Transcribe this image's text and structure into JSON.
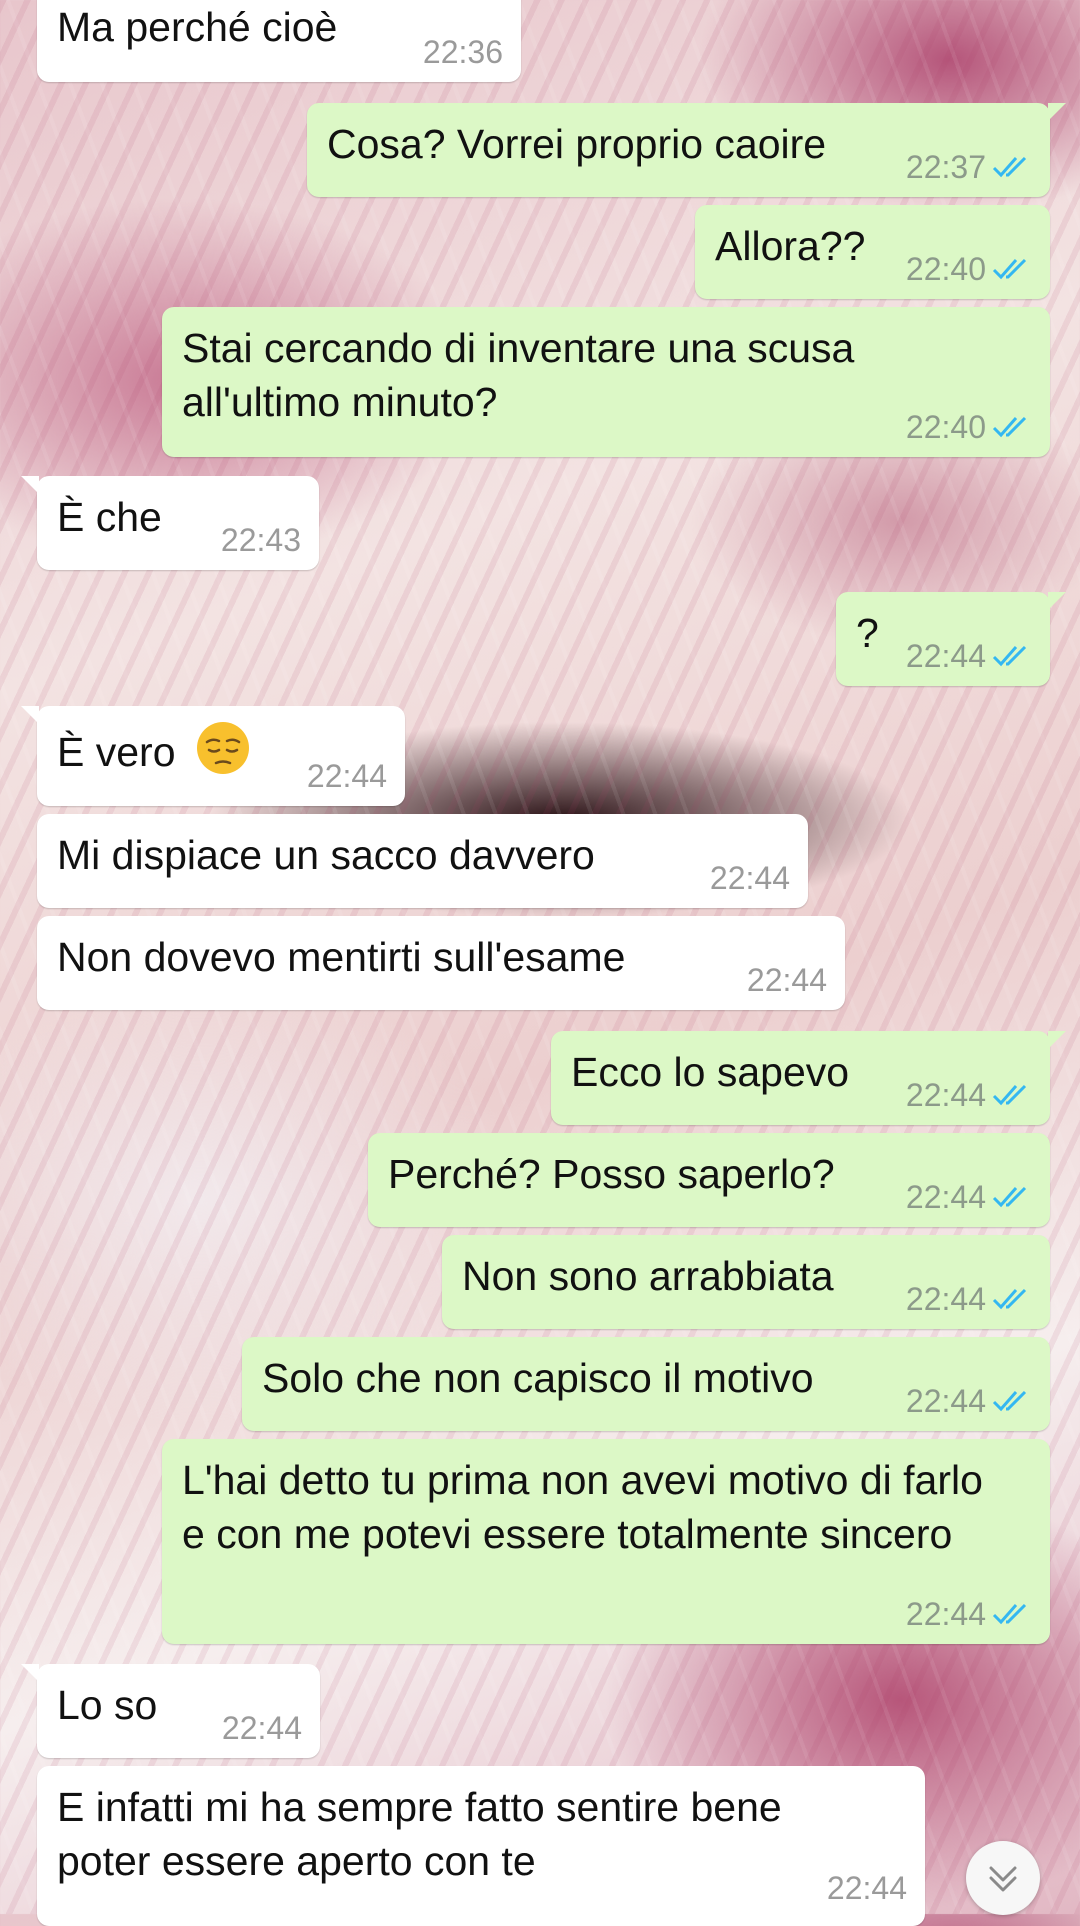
{
  "messages": [
    {
      "dir": "in",
      "text": "Ma perché cioè",
      "time": "22:36"
    },
    {
      "dir": "out",
      "text": "Cosa? Vorrei proprio caoire",
      "time": "22:37"
    },
    {
      "dir": "out",
      "text": "Allora??",
      "time": "22:40"
    },
    {
      "dir": "out",
      "text": "Stai cercando di inventare una scusa all'ultimo minuto?",
      "time": "22:40"
    },
    {
      "dir": "in",
      "text": "È che",
      "time": "22:43"
    },
    {
      "dir": "out",
      "text": "?",
      "time": "22:44"
    },
    {
      "dir": "in",
      "text": "È vero",
      "emoji": "pensive-face-emoji",
      "time": "22:44"
    },
    {
      "dir": "in",
      "text": "Mi dispiace un sacco davvero",
      "time": "22:44"
    },
    {
      "dir": "in",
      "text": "Non dovevo mentirti sull'esame",
      "time": "22:44"
    },
    {
      "dir": "out",
      "text": "Ecco lo sapevo",
      "time": "22:44"
    },
    {
      "dir": "out",
      "text": "Perché? Posso saperlo?",
      "time": "22:44"
    },
    {
      "dir": "out",
      "text": "Non sono arrabbiata",
      "time": "22:44"
    },
    {
      "dir": "out",
      "text": "Solo che non capisco il motivo",
      "time": "22:44"
    },
    {
      "dir": "out",
      "text": "L'hai detto tu prima non avevi motivo di farlo e con me potevi essere totalmente sincero",
      "time": "22:44"
    },
    {
      "dir": "in",
      "text": "Lo so",
      "time": "22:44"
    },
    {
      "dir": "in",
      "text": "E infatti mi ha sempre fatto sentire bene poter essere aperto con te",
      "time": "22:44"
    }
  ],
  "icons": {
    "read_receipt": "double-check-icon",
    "scroll_down": "double-chevron-down-icon"
  },
  "colors": {
    "outgoing_bubble": "#dcf8c6",
    "incoming_bubble": "#ffffff",
    "read_tick": "#34b7f1",
    "timestamp": "#9a9a9a"
  }
}
